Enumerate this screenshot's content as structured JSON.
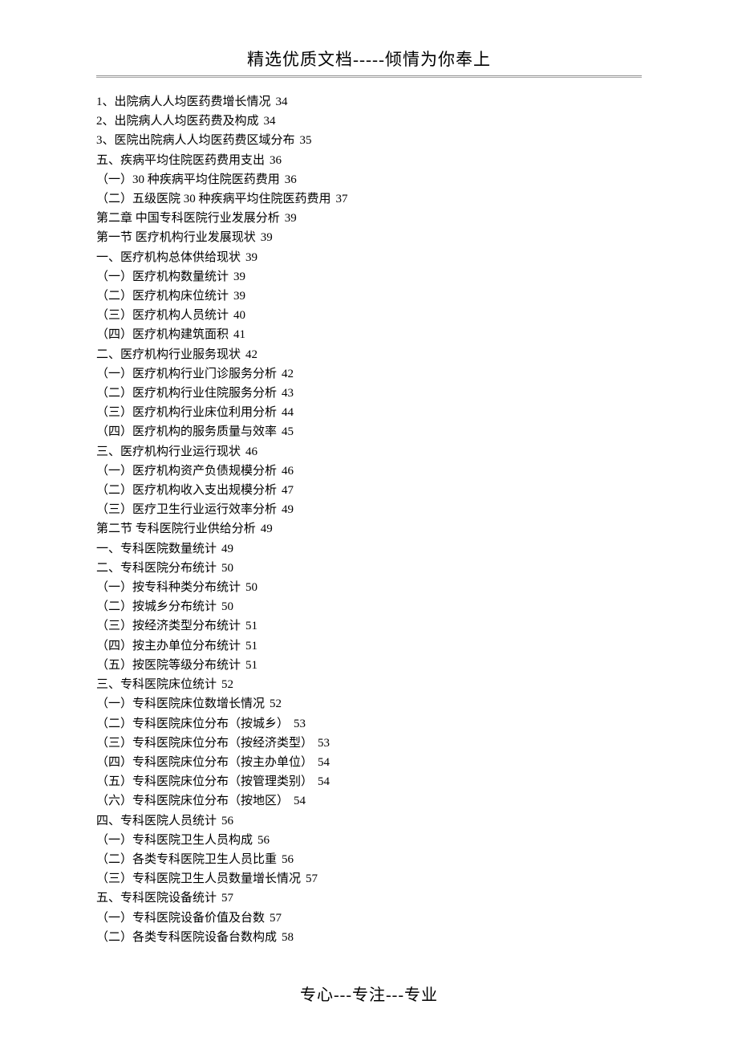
{
  "header": "精选优质文档-----倾情为你奉上",
  "footer": "专心---专注---专业",
  "toc": [
    {
      "text": "1、出院病人人均医药费增长情况",
      "page": "34"
    },
    {
      "text": "2、出院病人人均医药费及构成",
      "page": "34"
    },
    {
      "text": "3、医院出院病人人均医药费区域分布",
      "page": "35"
    },
    {
      "text": "五、疾病平均住院医药费用支出",
      "page": "36"
    },
    {
      "text": "（一）30 种疾病平均住院医药费用",
      "page": "36"
    },
    {
      "text": "（二）五级医院 30 种疾病平均住院医药费用",
      "page": "37"
    },
    {
      "text": "第二章 中国专科医院行业发展分析",
      "page": "39"
    },
    {
      "text": "第一节 医疗机构行业发展现状",
      "page": "39"
    },
    {
      "text": "一、医疗机构总体供给现状",
      "page": "39"
    },
    {
      "text": "（一）医疗机构数量统计",
      "page": "39"
    },
    {
      "text": "（二）医疗机构床位统计",
      "page": "39"
    },
    {
      "text": "（三）医疗机构人员统计",
      "page": "40"
    },
    {
      "text": "（四）医疗机构建筑面积",
      "page": "41"
    },
    {
      "text": "二、医疗机构行业服务现状",
      "page": "42"
    },
    {
      "text": "（一）医疗机构行业门诊服务分析",
      "page": "42"
    },
    {
      "text": "（二）医疗机构行业住院服务分析",
      "page": "43"
    },
    {
      "text": "（三）医疗机构行业床位利用分析",
      "page": "44"
    },
    {
      "text": "（四）医疗机构的服务质量与效率",
      "page": "45"
    },
    {
      "text": "三、医疗机构行业运行现状",
      "page": "46"
    },
    {
      "text": "（一）医疗机构资产负债规模分析",
      "page": "46"
    },
    {
      "text": "（二）医疗机构收入支出规模分析",
      "page": "47"
    },
    {
      "text": "（三）医疗卫生行业运行效率分析",
      "page": "49"
    },
    {
      "text": "第二节 专科医院行业供给分析",
      "page": "49"
    },
    {
      "text": "一、专科医院数量统计",
      "page": "49"
    },
    {
      "text": "二、专科医院分布统计",
      "page": "50"
    },
    {
      "text": "（一）按专科种类分布统计",
      "page": "50"
    },
    {
      "text": "（二）按城乡分布统计",
      "page": "50"
    },
    {
      "text": "（三）按经济类型分布统计",
      "page": "51"
    },
    {
      "text": "（四）按主办单位分布统计",
      "page": "51"
    },
    {
      "text": "（五）按医院等级分布统计",
      "page": "51"
    },
    {
      "text": "三、专科医院床位统计",
      "page": "52"
    },
    {
      "text": "（一）专科医院床位数增长情况",
      "page": "52"
    },
    {
      "text": "（二）专科医院床位分布（按城乡）",
      "page": "53"
    },
    {
      "text": "（三）专科医院床位分布（按经济类型）",
      "page": "53"
    },
    {
      "text": "（四）专科医院床位分布（按主办单位）",
      "page": "54"
    },
    {
      "text": "（五）专科医院床位分布（按管理类别）",
      "page": "54"
    },
    {
      "text": "（六）专科医院床位分布（按地区）",
      "page": "54"
    },
    {
      "text": "四、专科医院人员统计",
      "page": "56"
    },
    {
      "text": "（一）专科医院卫生人员构成",
      "page": "56"
    },
    {
      "text": "（二）各类专科医院卫生人员比重",
      "page": "56"
    },
    {
      "text": "（三）专科医院卫生人员数量增长情况",
      "page": "57"
    },
    {
      "text": "五、专科医院设备统计",
      "page": "57"
    },
    {
      "text": "（一）专科医院设备价值及台数",
      "page": "57"
    },
    {
      "text": "（二）各类专科医院设备台数构成",
      "page": "58"
    }
  ]
}
